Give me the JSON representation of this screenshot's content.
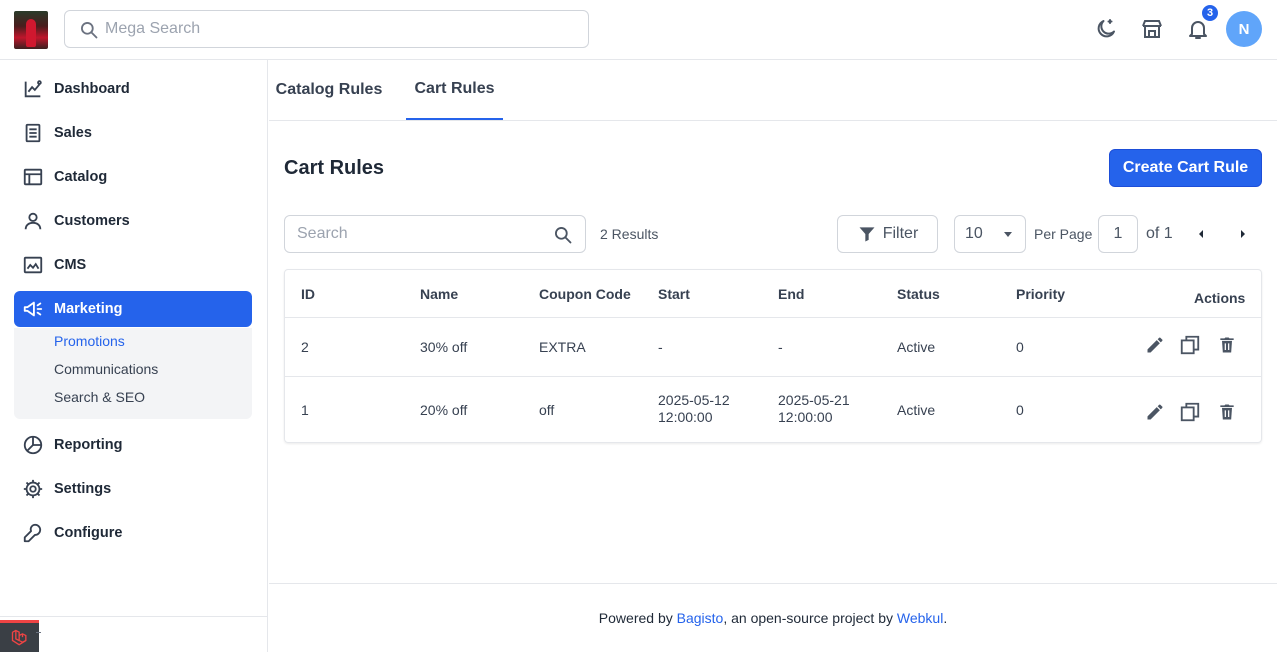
{
  "header": {
    "search_placeholder": "Mega Search",
    "notification_count": "3",
    "avatar_initial": "N",
    "accent": "#2563eb"
  },
  "sidebar": {
    "items": [
      {
        "label": "Dashboard",
        "icon": "dashboard-icon"
      },
      {
        "label": "Sales",
        "icon": "sales-icon"
      },
      {
        "label": "Catalog",
        "icon": "catalog-icon"
      },
      {
        "label": "Customers",
        "icon": "customers-icon"
      },
      {
        "label": "CMS",
        "icon": "cms-icon"
      },
      {
        "label": "Marketing",
        "icon": "marketing-icon",
        "active": true
      },
      {
        "label": "Reporting",
        "icon": "reporting-icon"
      },
      {
        "label": "Settings",
        "icon": "settings-icon"
      },
      {
        "label": "Configure",
        "icon": "configure-icon"
      }
    ],
    "submenu": [
      {
        "label": "Promotions",
        "active": true
      },
      {
        "label": "Communications"
      },
      {
        "label": "Search & SEO"
      }
    ]
  },
  "tabs": [
    {
      "label": "Catalog Rules"
    },
    {
      "label": "Cart Rules",
      "active": true
    }
  ],
  "page": {
    "title": "Cart Rules",
    "create_button": "Create Cart Rule"
  },
  "toolbar": {
    "search_placeholder": "Search",
    "results": "2 Results",
    "filter_label": "Filter",
    "per_page_value": "10",
    "per_page_label": "Per Page",
    "current_page": "1",
    "total_pages_label": "of 1"
  },
  "table": {
    "columns": [
      "ID",
      "Name",
      "Coupon Code",
      "Start",
      "End",
      "Status",
      "Priority",
      "Actions"
    ],
    "rows": [
      {
        "id": "2",
        "name": "30% off",
        "coupon": "EXTRA",
        "start": "-",
        "start2": "",
        "end": "-",
        "end2": "",
        "status": "Active",
        "priority": "0"
      },
      {
        "id": "1",
        "name": "20% off",
        "coupon": "off",
        "start": "2025-05-12",
        "start2": "12:00:00",
        "end": "2025-05-21",
        "end2": "12:00:00",
        "status": "Active",
        "priority": "0"
      }
    ]
  },
  "footer": {
    "prefix": "Powered by ",
    "link1": "Bagisto",
    "middle": ", an open-source project by ",
    "link2": "Webkul",
    "suffix": "."
  }
}
